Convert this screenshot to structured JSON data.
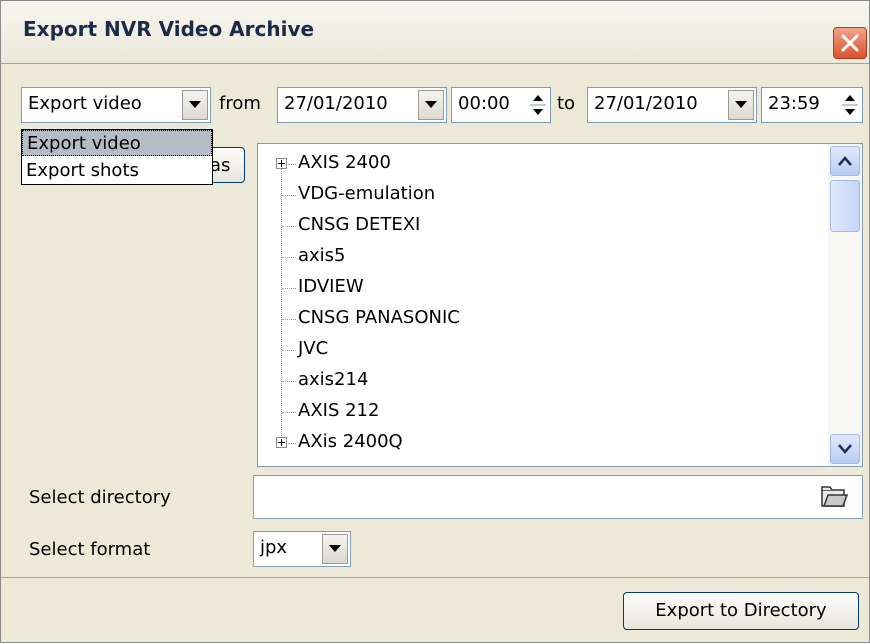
{
  "window": {
    "title": "Export NVR Video Archive"
  },
  "controls": {
    "mode_value": "Export video",
    "from_label": "from",
    "from_date": "27/01/2010",
    "from_time": "00:00",
    "to_label": "to",
    "to_date": "27/01/2010",
    "to_time": "23:59"
  },
  "mode_dropdown": {
    "options": [
      "Export video",
      "Export shots"
    ],
    "selected_index": 0
  },
  "cameras_button_partial_label": "as",
  "tree": {
    "items": [
      {
        "label": "AXIS 2400",
        "expandable": true
      },
      {
        "label": "VDG-emulation",
        "expandable": false
      },
      {
        "label": "CNSG DETEXI",
        "expandable": false
      },
      {
        "label": "axis5",
        "expandable": false
      },
      {
        "label": "IDVIEW",
        "expandable": false
      },
      {
        "label": "CNSG PANASONIC",
        "expandable": false
      },
      {
        "label": "JVC",
        "expandable": false
      },
      {
        "label": "axis214",
        "expandable": false
      },
      {
        "label": "AXIS 212",
        "expandable": false
      },
      {
        "label": "AXis 2400Q",
        "expandable": true
      }
    ]
  },
  "directory": {
    "label": "Select directory",
    "value": ""
  },
  "format": {
    "label": "Select format",
    "value": "jpx"
  },
  "export_button": "Export to Directory",
  "colors": {
    "window_bg": "#ece9d8",
    "title_text": "#1d2a48",
    "close_red": "#d8532f",
    "field_border": "#7f9db9"
  }
}
